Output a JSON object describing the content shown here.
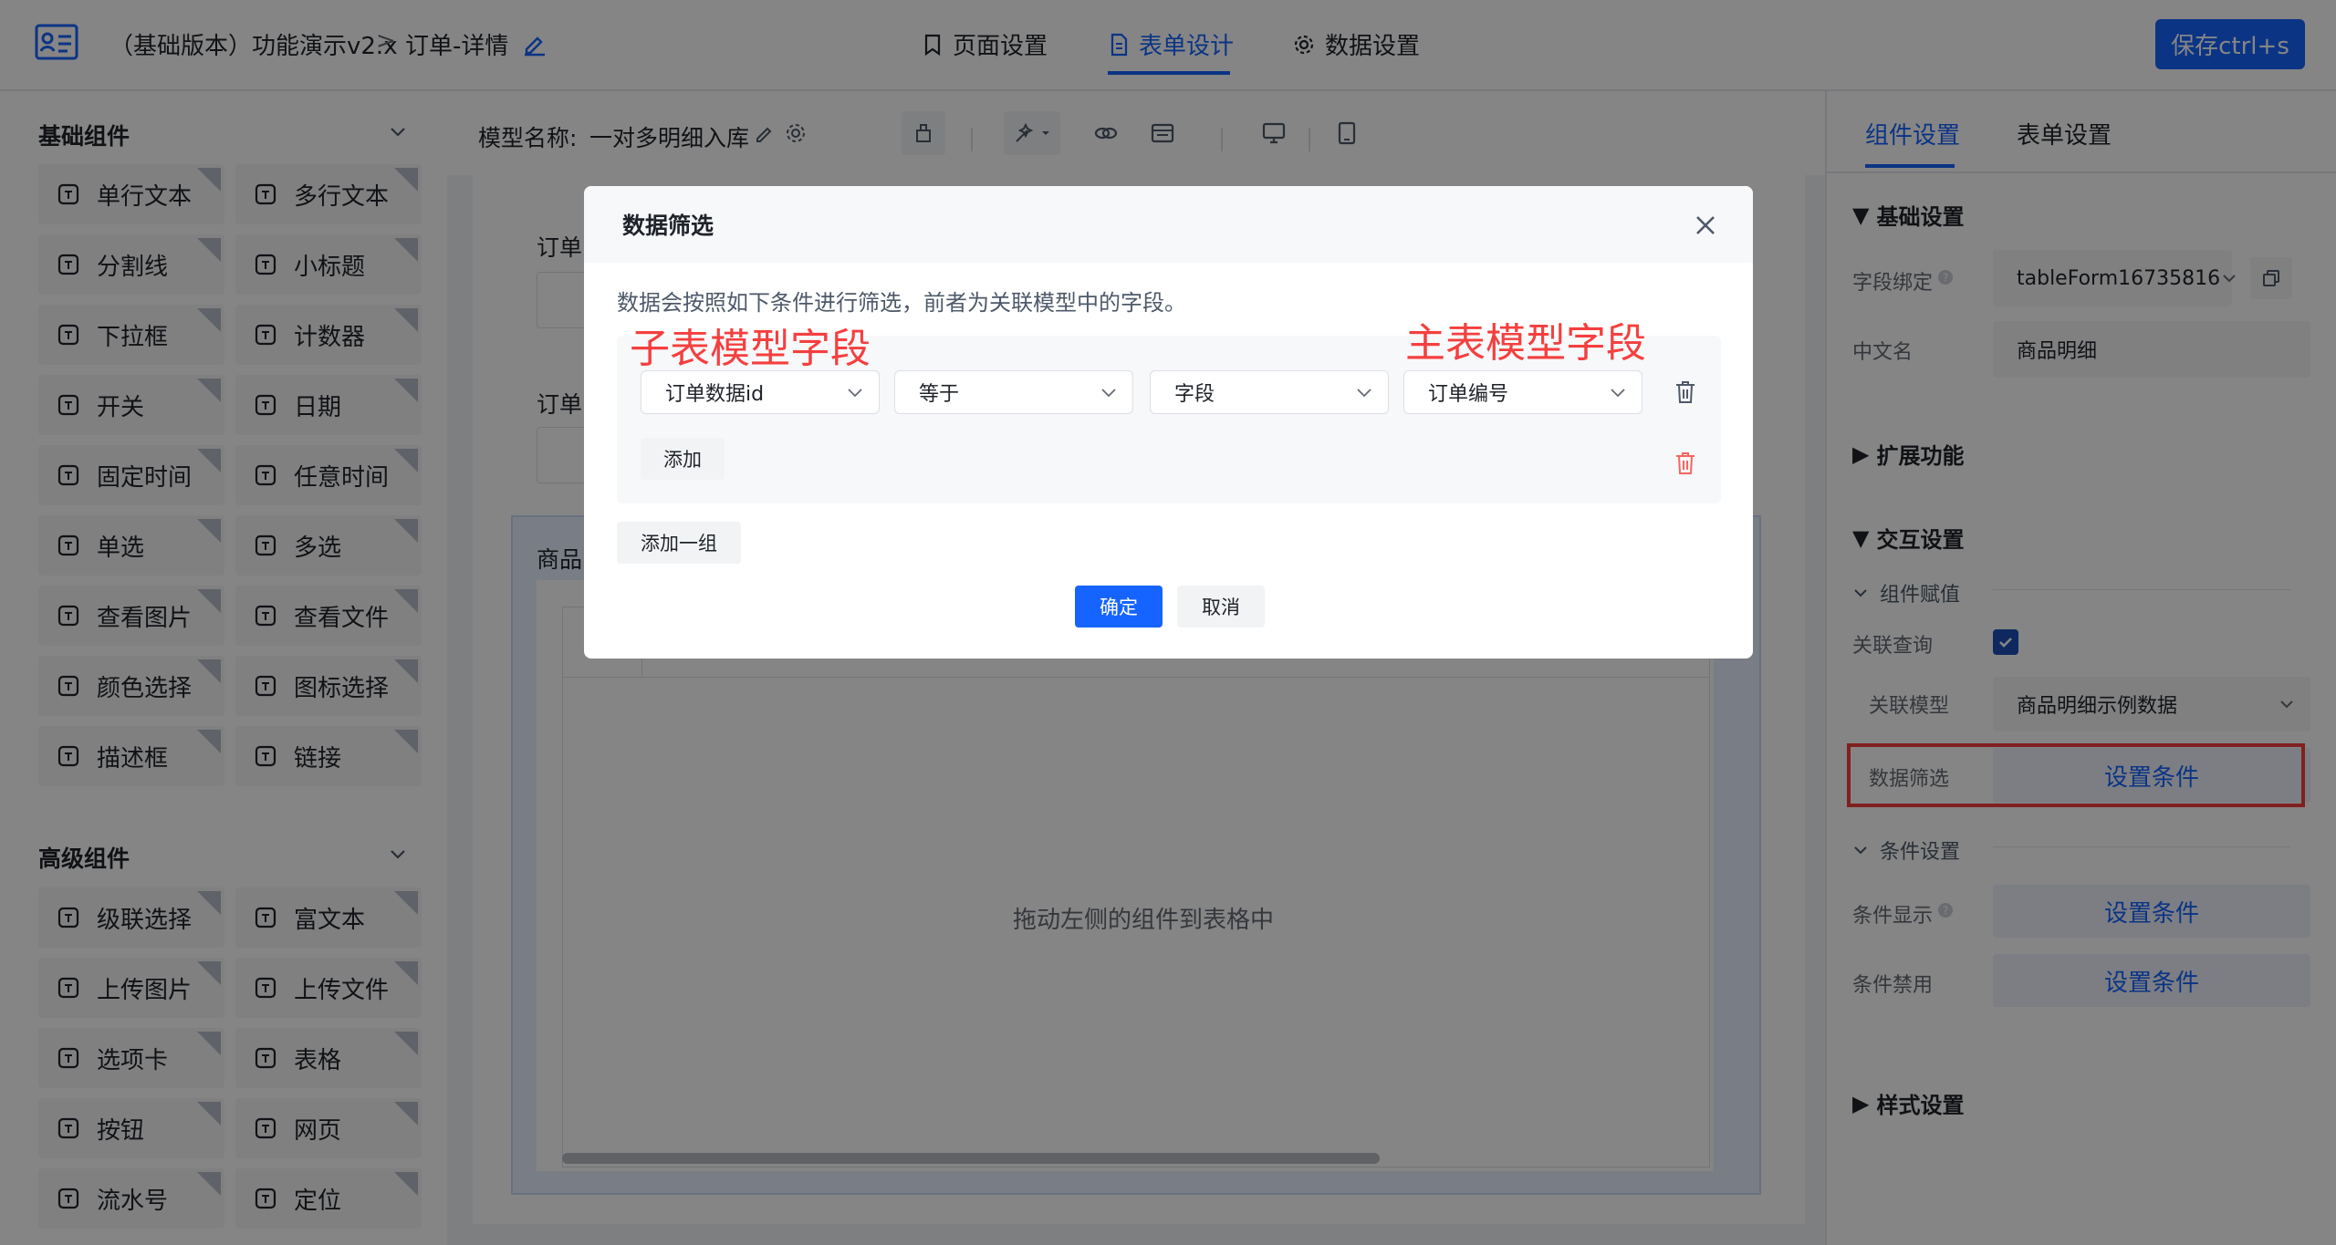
{
  "header": {
    "app_name": "（基础版本）功能演示v2.x",
    "separator": ">",
    "page_name": "订单-详情",
    "tabs": [
      {
        "label": "页面设置",
        "icon": "bookmark-icon"
      },
      {
        "label": "表单设计",
        "icon": "document-icon"
      },
      {
        "label": "数据设置",
        "icon": "gear-icon"
      }
    ],
    "active_tab": "表单设计",
    "save_label": "保存ctrl+s",
    "accent_color": "#1664ff"
  },
  "left_panel": {
    "basic_title": "基础组件",
    "basic_items": [
      "单行文本",
      "多行文本",
      "分割线",
      "小标题",
      "下拉框",
      "计数器",
      "开关",
      "日期",
      "固定时间",
      "任意时间",
      "单选",
      "多选",
      "查看图片",
      "查看文件",
      "颜色选择",
      "图标选择",
      "描述框",
      "链接"
    ],
    "advanced_title": "高级组件",
    "advanced_items": [
      "级联选择",
      "富文本",
      "上传图片",
      "上传文件",
      "选项卡",
      "表格",
      "按钮",
      "网页",
      "流水号",
      "定位"
    ]
  },
  "canvas": {
    "model_label": "模型名称:",
    "model_name": "一对多明细入库",
    "field_label_1": "订单",
    "field_label_2": "订单",
    "table_label": "商品",
    "table_placeholder": "拖动左侧的组件到表格中"
  },
  "right_panel": {
    "tabs": [
      "组件设置",
      "表单设置"
    ],
    "active_tab": "组件设置",
    "basic_settings": "基础设置",
    "field_binding_label": "字段绑定",
    "field_binding_value": "tableForm16735816",
    "cn_name_label": "中文名",
    "cn_name_value": "商品明细",
    "extend": "扩展功能",
    "interaction": "交互设置",
    "assign": "组件赋值",
    "related_query_label": "关联查询",
    "related_query_checked": true,
    "related_model_label": "关联模型",
    "related_model_value": "商品明细示例数据",
    "data_filter_label": "数据筛选",
    "set_condition": "设置条件",
    "condition_settings": "条件设置",
    "condition_show_label": "条件显示",
    "condition_disable_label": "条件禁用",
    "style_settings": "样式设置",
    "highlight_color": "#f53f3f"
  },
  "modal": {
    "title": "数据筛选",
    "description": "数据会按照如下条件进行筛选，前者为关联模型中的字段。",
    "annotation_left": "子表模型字段",
    "annotation_right": "主表模型字段",
    "row": {
      "field": "订单数据id",
      "operator": "等于",
      "value_type": "字段",
      "value": "订单编号"
    },
    "add_label": "添加",
    "add_group_label": "添加一组",
    "confirm_label": "确定",
    "cancel_label": "取消"
  }
}
